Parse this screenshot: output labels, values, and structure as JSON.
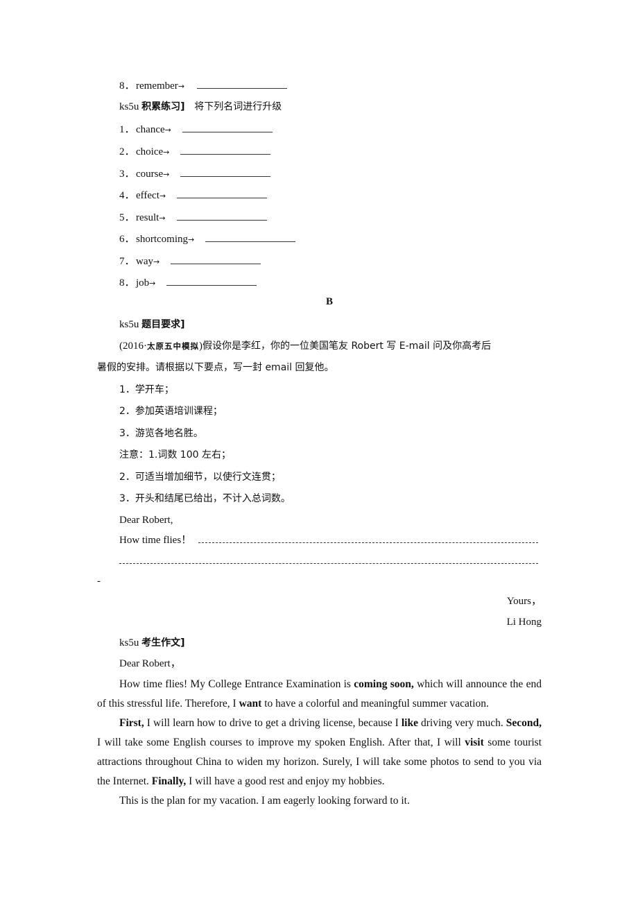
{
  "top_item": {
    "num": "8．",
    "word": "remember",
    "arrow": "→"
  },
  "section_practice": {
    "tag": "ks5u",
    "title": "积累练习]",
    "instruction": "将下列名词进行升级",
    "items": [
      {
        "num": "1．",
        "word": "chance",
        "arrow": "→"
      },
      {
        "num": "2．",
        "word": "choice",
        "arrow": "→"
      },
      {
        "num": "3．",
        "word": "course",
        "arrow": "→"
      },
      {
        "num": "4．",
        "word": "effect",
        "arrow": "→"
      },
      {
        "num": "5．",
        "word": "result",
        "arrow": "→"
      },
      {
        "num": "6．",
        "word": "shortcoming",
        "arrow": "→"
      },
      {
        "num": "7．",
        "word": "way",
        "arrow": "→"
      },
      {
        "num": "8．",
        "word": "job",
        "arrow": "→"
      }
    ]
  },
  "section_b": {
    "heading": "B",
    "req_tag": "ks5u",
    "req_title": "题目要求]",
    "source_open": "(2016·",
    "source_name": "太原五中模拟",
    "source_close": ")",
    "prompt_line1": "假设你是李红，你的一位美国笔友 Robert 写 E-mail 问及你高考后",
    "prompt_line2": "暑假的安排。请根据以下要点，写一封 email 回复他。",
    "points": [
      "1．学开车；",
      "2．参加英语培训课程；",
      "3．游览各地名胜。"
    ],
    "notes": [
      "注意：1.词数 100 左右；",
      "2．可适当增加细节，以使行文连贯；",
      "3．开头和结尾已给出，不计入总词数。"
    ],
    "greeting": "Dear Robert,",
    "opening": "How time flies！",
    "trailing_dash": "-",
    "closing": "Yours，",
    "signature": "Li Hong"
  },
  "essay": {
    "tag": "ks5u",
    "title": "考生作文]",
    "greeting": "Dear Robert，",
    "p1": [
      {
        "t": "How time flies! My College Entrance Examination is ",
        "b": false
      },
      {
        "t": "coming soon,",
        "b": true
      },
      {
        "t": " which will announce the end of this stressful life. Therefore, I ",
        "b": false
      },
      {
        "t": "want",
        "b": true
      },
      {
        "t": " to have a colorful and meaningful summer vacation.",
        "b": false
      }
    ],
    "p2": [
      {
        "t": "First,",
        "b": true
      },
      {
        "t": " I will learn how to drive to get a driving license, because I ",
        "b": false
      },
      {
        "t": "like",
        "b": true
      },
      {
        "t": " driving very much. ",
        "b": false
      },
      {
        "t": "Second,",
        "b": true
      },
      {
        "t": " I will take some English courses to improve my spoken English. After that, I will ",
        "b": false
      },
      {
        "t": "visit",
        "b": true
      },
      {
        "t": " some tourist attractions throughout China to widen my horizon. Surely, I will take some photos to send to you via the Internet. ",
        "b": false
      },
      {
        "t": "Finally,",
        "b": true
      },
      {
        "t": " I will have a good rest and enjoy my hobbies.",
        "b": false
      }
    ],
    "p3": [
      {
        "t": "This is the plan for my vacation. I am eagerly looking forward to it.",
        "b": false
      }
    ]
  }
}
